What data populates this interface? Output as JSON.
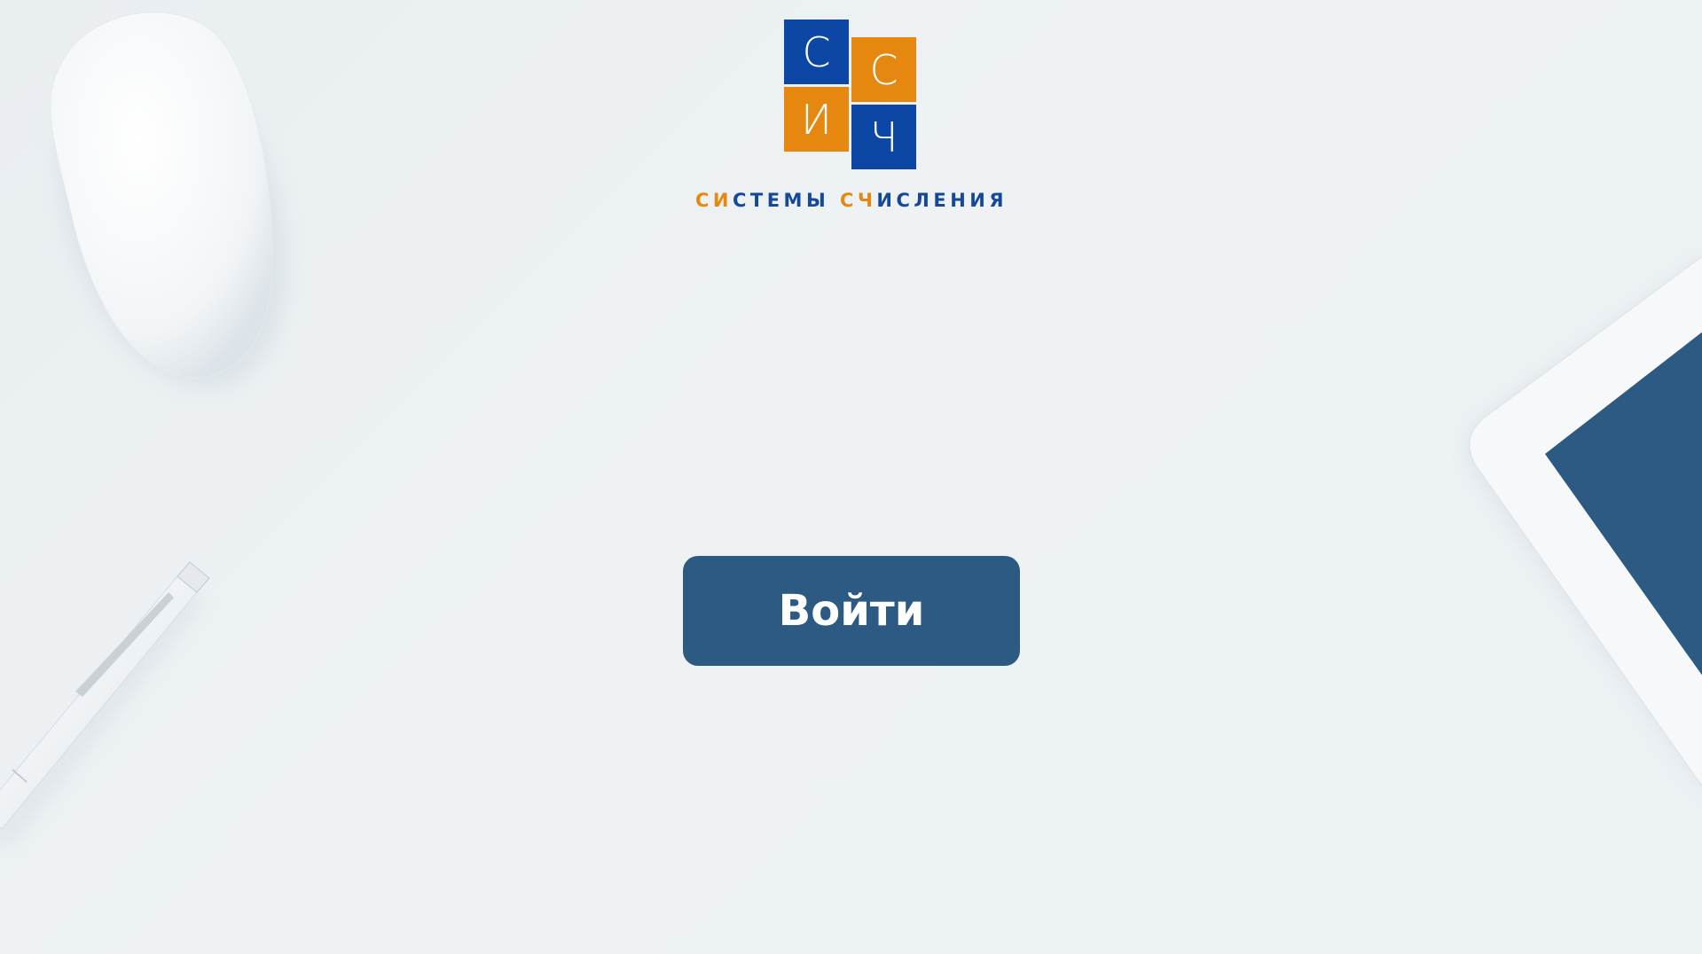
{
  "logo": {
    "tiles": [
      "С",
      "С",
      "И",
      "Ч"
    ],
    "caption": {
      "part1_orange": "СИ",
      "part1_blue": "СТЕМЫ ",
      "part2_orange": "СЧ",
      "part2_blue": "ИСЛЕНИЯ"
    },
    "colors": {
      "blue": "#0d47a6",
      "orange": "#e6880f"
    }
  },
  "login": {
    "label": "Войти",
    "color": "#2d5a82"
  },
  "decor": {
    "items": [
      "mouse-icon",
      "pen-icon",
      "tablet-icon"
    ]
  }
}
